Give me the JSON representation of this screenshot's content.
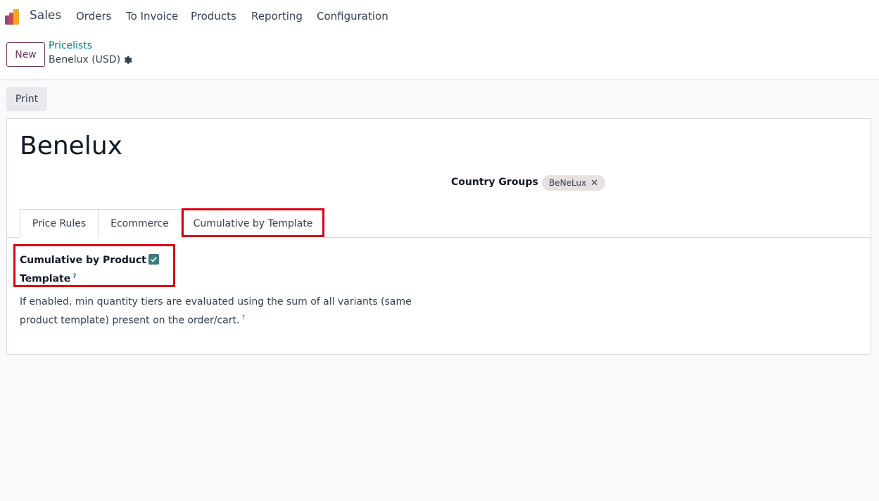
{
  "nav": {
    "app_name": "Sales",
    "items": [
      "Orders",
      "To Invoice",
      "Products",
      "Reporting",
      "Configuration"
    ]
  },
  "control_panel": {
    "new_label": "New",
    "breadcrumb": "Pricelists",
    "record_name": "Benelux (USD)"
  },
  "print_label": "Print",
  "form": {
    "title": "Benelux",
    "country_groups_label": "Country Groups",
    "country_group_tag": "BeNeLux",
    "tabs": [
      "Price Rules",
      "Ecommerce",
      "Cumulative by Template"
    ],
    "cumulative_label": "Cumulative by Product Template",
    "cumulative_checked": true,
    "description": "If enabled, min quantity tiers are evaluated using the sum of all variants (same product template) present on the order/cart.",
    "help_mark": "?"
  },
  "colors": {
    "accent_teal": "#017e84",
    "brand_purple": "#71395f",
    "highlight_red": "#dc0014",
    "checkbox": "#3d7a80"
  }
}
